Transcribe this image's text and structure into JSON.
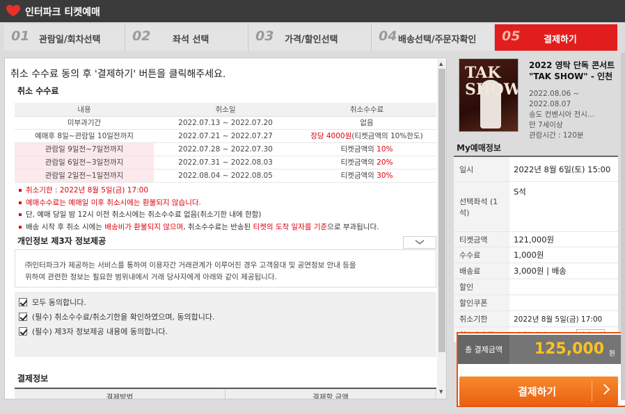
{
  "app": {
    "title": "인터파크 티켓예매"
  },
  "steps": [
    {
      "num": "01",
      "label": "관람일/회차선택"
    },
    {
      "num": "02",
      "label": "좌석 선택"
    },
    {
      "num": "03",
      "label": "가격/할인선택"
    },
    {
      "num": "04",
      "label": "배송선택/주문자확인"
    },
    {
      "num": "05",
      "label": "결제하기"
    }
  ],
  "main": {
    "instruction": "취소 수수료 동의 후 '결제하기' 버튼을 클릭해주세요.",
    "fee_section": "취소 수수료",
    "fee_headers": [
      "내용",
      "취소일",
      "취소수수료"
    ],
    "fee_rows": [
      {
        "c": "미부과기간",
        "d": "2022.07.13 ~ 2022.07.20",
        "f": "없음"
      },
      {
        "c": "예매후 8일~관람일 10일전까지",
        "d": "2022.07.21 ~ 2022.07.27",
        "f1": "장당 4000원",
        "f2": "(티켓금액의 10%한도)"
      },
      {
        "c": "관람일 9일전~7일전까지",
        "d": "2022.07.28 ~ 2022.07.30",
        "f1": "티켓금액의 ",
        "f2": "10%"
      },
      {
        "c": "관람일 6일전~3일전까지",
        "d": "2022.07.31 ~ 2022.08.03",
        "f1": "티켓금액의 ",
        "f2": "20%"
      },
      {
        "c": "관람일 2일전~1일전까지",
        "d": "2022.08.04 ~ 2022.08.05",
        "f1": "티켓금액의 ",
        "f2": "30%"
      }
    ],
    "notes": {
      "n1": "취소기한 : 2022년 8월 5일(금) 17:00",
      "n2": "예매수수료는 예매일 이후 취소시에는 환불되지 않습니다.",
      "n3": "단, 예매 당일 밤 12시 이전 취소시에는 취소수수료 없음(취소기한 내에 한함)",
      "n4a": "배송 시작 후 취소 시에는 ",
      "n4b": "배송비가 환불되지 않으며",
      "n4c": ", 취소수수료는 반송된 ",
      "n4d": "티켓의 도착 일자를 기준",
      "n4e": "으로 부과됩니다."
    },
    "privacy_section": "개인정보 제3자 정보제공",
    "privacy_text1": "㈜인터파크가 제공하는 서비스를 통하여 이용자간 거래관계가 이루어진 경우 고객응대 및 공연정보 안내 등을",
    "privacy_text2": "위하여 관련한 정보는 필요한 범위내에서 거래 당사자에게 아래와 같이 제공됩니다.",
    "agree": [
      "모두 동의합니다.",
      "(필수) 취소수수료/취소기한을 확인하였으며, 동의합니다.",
      "(필수) 제3자 정보제공 내용에 동의합니다."
    ],
    "payinfo_section": "결제정보",
    "pay_headers": [
      "결제방법",
      "결제할 금액"
    ]
  },
  "show": {
    "poster_text": "TAK SHOW",
    "title": "2022 영탁 단독 콘서트 \"TAK SHOW\" - 인천",
    "date": "2022.08.06 ~ 2022.08.07",
    "venue": "송도 컨벤시아 전시...",
    "age": "만 7세이상",
    "runtime": "관람시간 : 120분"
  },
  "myinfo": {
    "title": "My예매정보",
    "rows": [
      {
        "k": "일시",
        "v": "2022년 8월 6일(토) 15:00"
      },
      {
        "k": "선택좌석 (1석)",
        "v": "S석"
      },
      {
        "k": "티켓금액",
        "v": "121,000원"
      },
      {
        "k": "수수료",
        "v": "1,000원"
      },
      {
        "k": "배송료",
        "v": "3,000원 | 배송"
      },
      {
        "k": "할인",
        "v": ""
      },
      {
        "k": "할인쿠폰",
        "v": ""
      },
      {
        "k": "취소기한",
        "v": "2022년 8월 5일(금) 17:00"
      },
      {
        "k": "취소수수료",
        "v": "티켓금액의 0~30%"
      }
    ],
    "detail_btn": "상세보기",
    "total_label": "총 결제금액",
    "total_amount": "125,000",
    "total_unit": "원",
    "pay_button": "결제하기"
  },
  "colors": {
    "accent": "#e21d1d",
    "orange": "#ea6011",
    "gold": "#ffc21e"
  }
}
